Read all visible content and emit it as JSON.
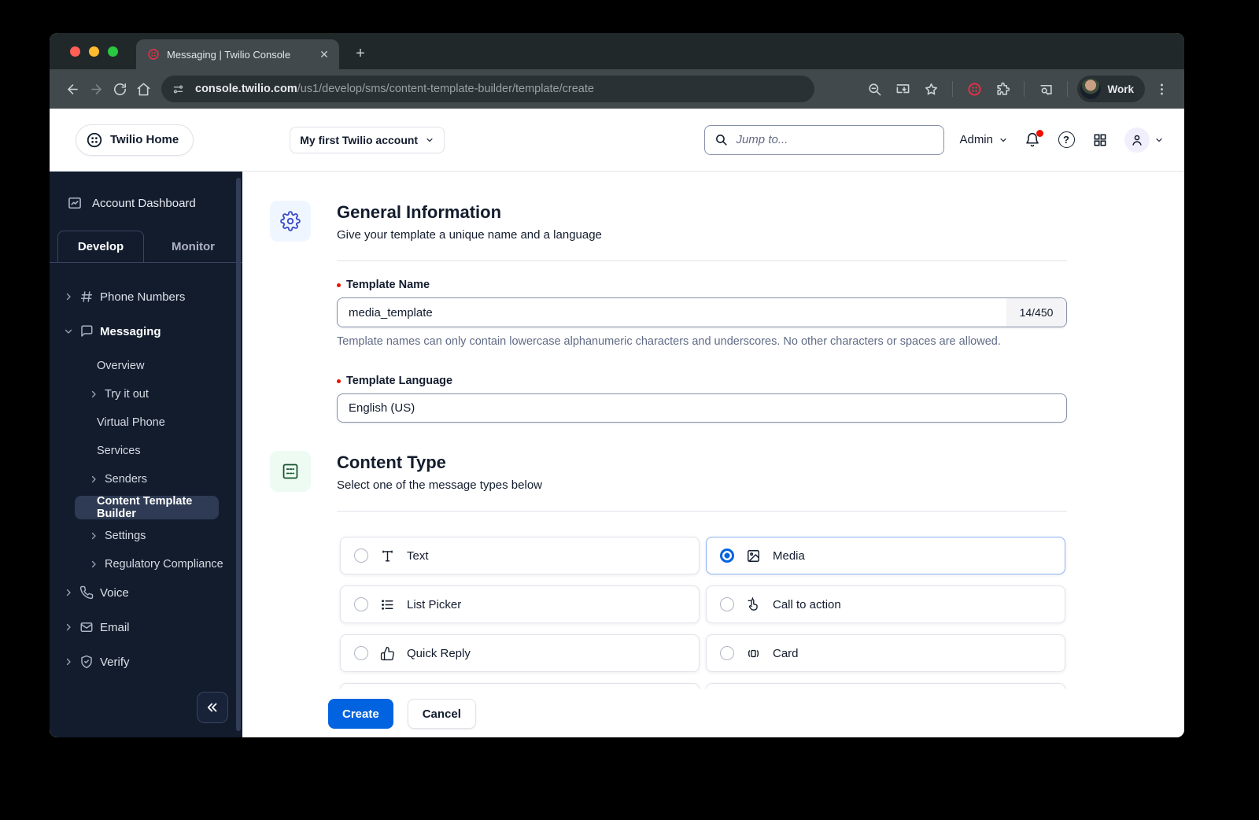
{
  "browser": {
    "tab_title": "Messaging | Twilio Console",
    "url_host": "console.twilio.com",
    "url_path": "/us1/develop/sms/content-template-builder/template/create",
    "profile_label": "Work"
  },
  "topnav": {
    "home_label": "Twilio Home",
    "account_label": "My first Twilio account",
    "search_placeholder": "Jump to...",
    "admin_label": "Admin"
  },
  "sidebar": {
    "dashboard_label": "Account Dashboard",
    "tabs": {
      "develop": "Develop",
      "monitor": "Monitor"
    },
    "phone_numbers": "Phone Numbers",
    "messaging": "Messaging",
    "messaging_children": {
      "overview": "Overview",
      "try_it_out": "Try it out",
      "virtual_phone": "Virtual Phone",
      "services": "Services",
      "senders": "Senders",
      "content_template_builder": "Content Template Builder",
      "settings": "Settings",
      "regulatory_compliance": "Regulatory Compliance"
    },
    "voice": "Voice",
    "email": "Email",
    "verify": "Verify"
  },
  "main": {
    "general": {
      "title": "General Information",
      "subtitle": "Give your template a unique name and a language",
      "name_label": "Template Name",
      "name_value": "media_template",
      "name_counter": "14/450",
      "name_help": "Template names can only contain lowercase alphanumeric characters and underscores. No other characters or spaces are allowed.",
      "language_label": "Template Language",
      "language_value": "English (US)"
    },
    "content_type": {
      "title": "Content Type",
      "subtitle": "Select one of the message types below",
      "options": [
        {
          "label": "Text",
          "icon": "text-icon",
          "selected": false
        },
        {
          "label": "Media",
          "icon": "media-icon",
          "selected": true
        },
        {
          "label": "List Picker",
          "icon": "list-picker-icon",
          "selected": false
        },
        {
          "label": "Call to action",
          "icon": "call-to-action-icon",
          "selected": false
        },
        {
          "label": "Quick Reply",
          "icon": "quick-reply-icon",
          "selected": false
        },
        {
          "label": "Card",
          "icon": "card-icon",
          "selected": false
        }
      ]
    },
    "actions": {
      "create_label": "Create",
      "cancel_label": "Cancel"
    }
  },
  "colors": {
    "accent_blue": "#0263E0",
    "brand_red": "#F22F46",
    "navy": "#121C2D",
    "selected_border": "#8CB2F5",
    "notification_red": "#EB1000",
    "required_red": "#EB1000"
  }
}
